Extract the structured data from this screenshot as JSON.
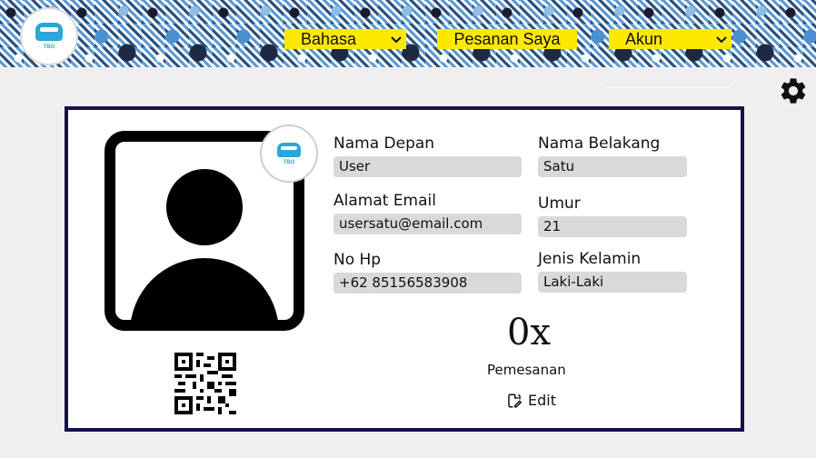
{
  "header": {
    "logo_text": "TBO",
    "nav": {
      "language_label": "Bahasa",
      "orders_label": "Pesanan Saya",
      "account_label": "Akun"
    }
  },
  "profile": {
    "badge_text": "TBO",
    "fields": {
      "first_name": {
        "label": "Nama Depan",
        "value": "User"
      },
      "last_name": {
        "label": "Nama Belakang",
        "value": "Satu"
      },
      "email": {
        "label": "Alamat Email",
        "value": "usersatu@email.com"
      },
      "age": {
        "label": "Umur",
        "value": "21"
      },
      "phone": {
        "label": "No Hp",
        "value": "+62  85156583908"
      },
      "gender": {
        "label": "Jenis Kelamin",
        "value": "Laki-Laki"
      }
    },
    "orders_count": "0x",
    "orders_label": "Pemesanan",
    "edit_label": "Edit"
  },
  "icons": {
    "settings": "gear-icon",
    "edit": "edit-file-icon",
    "qr": "qr-code-icon",
    "avatar": "user-avatar-icon"
  },
  "colors": {
    "nav_button": "#ffe800",
    "card_border": "#14134a",
    "field_bg": "#d9d9d9",
    "logo_accent": "#2aa6d9"
  }
}
